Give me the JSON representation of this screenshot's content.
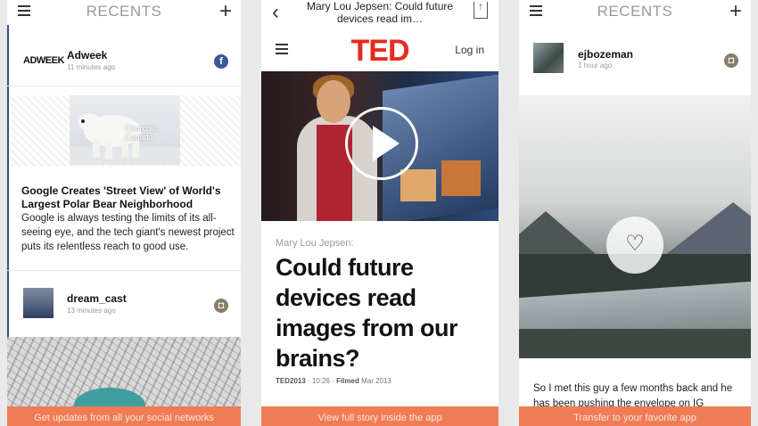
{
  "phone1": {
    "header": {
      "title": "RECENTS"
    },
    "post1": {
      "source": "Adweek",
      "logo_text": "ADWEEK",
      "time": "11 minutes ago",
      "badge": "f"
    },
    "image_caption": "Churchill, Canada",
    "article": {
      "title": "Google Creates 'Street View' of World's Largest Polar Bear Neighborhood",
      "body": "Google is always testing the limits of its all-seeing eye, and the tech giant's newest project puts its relentless reach to good use."
    },
    "post2": {
      "user": "dream_cast",
      "time": "13 minutes ago"
    },
    "footer_text": "Get updates from all your social networks"
  },
  "phone2": {
    "nav": {
      "title": "Mary Lou Jepsen: Could future devices read im…"
    },
    "logo": "TED",
    "login_label": "Log in",
    "speaker": "Mary Lou Jepsen:",
    "talk_title": "Could future devices read images from our brains?",
    "meta": {
      "event": "TED2013",
      "duration": "· 10:26 ·",
      "filmed_label": "Filmed",
      "filmed_date": "Mar 2013"
    },
    "footer_text": "View full story inside the app"
  },
  "phone3": {
    "header": {
      "title": "RECENTS"
    },
    "post": {
      "user": "ejbozeman",
      "time": "1 hour ago"
    },
    "caption": "So I met this guy a few months back and he has been pushing the envelope on IG",
    "footer_text": "Transfer to your favorite app"
  },
  "colors": {
    "accent": "#f07c56",
    "ted_red": "#e62b1e",
    "facebook": "#3b5998",
    "instagram": "#8a7c6b"
  },
  "icons": [
    "menu-icon",
    "plus-icon",
    "facebook-icon",
    "instagram-icon",
    "back-chevron-icon",
    "share-icon",
    "play-icon",
    "heart-icon"
  ]
}
